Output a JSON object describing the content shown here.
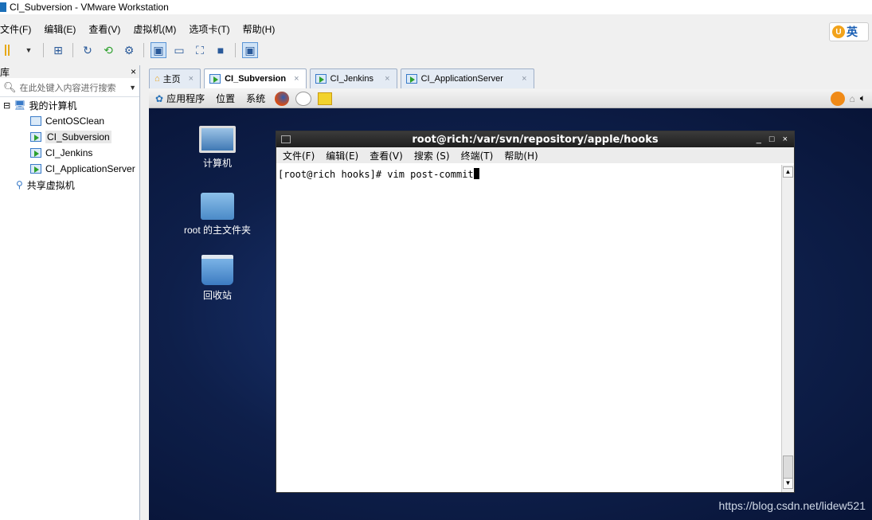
{
  "window": {
    "title": "CI_Subversion - VMware Workstation"
  },
  "menu": [
    "文件(F)",
    "编辑(E)",
    "查看(V)",
    "虚拟机(M)",
    "选项卡(T)",
    "帮助(H)"
  ],
  "ime": {
    "text": "英"
  },
  "library": {
    "header": "库",
    "close": "×",
    "search_placeholder": "在此处键入内容进行搜索",
    "tree": [
      {
        "label": "我的计算机",
        "level": 0,
        "expand": "⊟"
      },
      {
        "label": "CentOSClean",
        "level": 1
      },
      {
        "label": "CI_Subversion",
        "level": 1,
        "selected": true
      },
      {
        "label": "CI_Jenkins",
        "level": 1
      },
      {
        "label": "CI_ApplicationServer",
        "level": 1
      },
      {
        "label": "共享虚拟机",
        "level": 0
      }
    ]
  },
  "tabs": [
    {
      "label": "主页",
      "close": "×"
    },
    {
      "label": "CI_Subversion",
      "close": "×",
      "active": true
    },
    {
      "label": "CI_Jenkins",
      "close": "×"
    },
    {
      "label": "CI_ApplicationServer",
      "close": "×"
    }
  ],
  "guest_panel": {
    "apps": "应用程序",
    "places": "位置",
    "system": "系统"
  },
  "desktop_icons": [
    {
      "label": "计算机",
      "icon": "computer-icon"
    },
    {
      "label": "root 的主文件夹",
      "icon": "home-folder-icon"
    },
    {
      "label": "回收站",
      "icon": "trash-icon"
    }
  ],
  "terminal": {
    "title": "root@rich:/var/svn/repository/apple/hooks",
    "menu": [
      "文件(F)",
      "编辑(E)",
      "查看(V)",
      "搜索 (S)",
      "终端(T)",
      "帮助(H)"
    ],
    "controls": [
      "_",
      "□",
      "×"
    ],
    "line": "[root@rich hooks]# vim post-commit"
  },
  "watermark": "https://blog.csdn.net/lidew521"
}
